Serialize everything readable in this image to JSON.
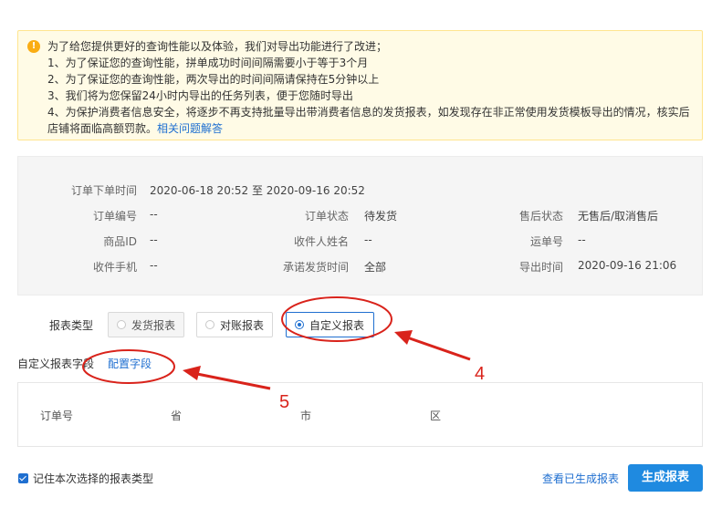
{
  "notice": {
    "icon": "exclamation-icon",
    "color": "#faad14",
    "line1": "为了给您提供更好的查询性能以及体验，我们对导出功能进行了改进；",
    "line2": "1、为了保证您的查询性能，拼单成功时间间隔需要小于等于3个月",
    "line3": "2、为了保证您的查询性能，两次导出的时间间隔请保持在5分钟以上",
    "line4": "3、我们将为您保留24小时内导出的任务列表，便于您随时导出",
    "line5": "4、为保护消费者信息安全，将逐步不再支持批量导出带消费者信息的发货报表，如发现存在非正常使用发货模板导出的情况，核实后店铺将面临高额罚款。",
    "link": "相关问题解答"
  },
  "filters": {
    "order_time_label": "订单下单时间",
    "order_time_value": "2020-06-18 20:52 至 2020-09-16 20:52",
    "order_no_label": "订单编号",
    "order_no_value": "--",
    "order_status_label": "订单状态",
    "order_status_value": "待发货",
    "after_sale_label": "售后状态",
    "after_sale_value": "无售后/取消售后",
    "goods_id_label": "商品ID",
    "goods_id_value": "--",
    "receiver_label": "收件人姓名",
    "receiver_value": "--",
    "tracking_label": "运单号",
    "tracking_value": "--",
    "phone_label": "收件手机",
    "phone_value": "--",
    "promise_label": "承诺发货时间",
    "promise_value": "全部",
    "export_time_label": "导出时间",
    "export_time_value": "2020-09-16 21:06"
  },
  "report_type": {
    "label": "报表类型",
    "options": [
      "发货报表",
      "对账报表",
      "自定义报表"
    ],
    "selected": "自定义报表"
  },
  "custom_fields": {
    "label": "自定义报表字段",
    "config_link": "配置字段",
    "columns": [
      "订单号",
      "省",
      "市",
      "区"
    ]
  },
  "footer": {
    "remember_label": "记住本次选择的报表类型",
    "remember_checked": true,
    "view_link": "查看已生成报表",
    "generate_button": "生成报表",
    "accent": "#1f8ae0"
  },
  "annotations": {
    "num4": "4",
    "num5": "5",
    "color": "#d9231b"
  }
}
